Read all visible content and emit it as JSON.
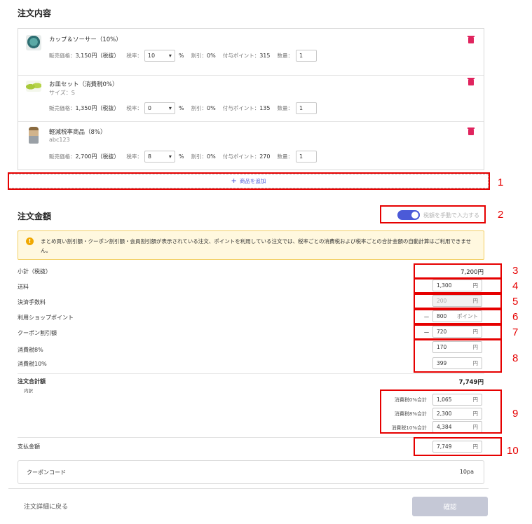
{
  "order_contents": {
    "title": "注文内容",
    "price_label": "販売価格：",
    "tax_rate_label": "税率：",
    "percent": "%",
    "discount_label": "割引：",
    "points_label": "付与ポイント：",
    "quantity_label": "数量：",
    "products": [
      {
        "name": "カップ＆ソーサー（10%）",
        "sub": "",
        "price": "3,150円（税抜）",
        "tax_rate": "10",
        "discount": "0%",
        "points": "315",
        "quantity": "1"
      },
      {
        "name": "お皿セット（消費税0%）",
        "sub": "サイズ：S",
        "price": "1,350円（税抜）",
        "tax_rate": "0",
        "discount": "0%",
        "points": "135",
        "quantity": "1"
      },
      {
        "name": "軽減税率商品（8%）",
        "sub": "abc123",
        "price": "2,700円（税抜）",
        "tax_rate": "8",
        "discount": "0%",
        "points": "270",
        "quantity": "1"
      }
    ],
    "add_product_label": "商品を追加"
  },
  "order_amount": {
    "title": "注文金額",
    "manual_toggle_label": "税額を手動で入力する",
    "manual_toggle_on": true,
    "notice": "まとめ買い割引額・クーポン割引額・会員割引額が表示されている注文、ポイントを利用している注文では、税率ごとの消費税および税率ごとの合計金額の自動計算はご利用できません。",
    "subtotal_label": "小計（税抜）",
    "subtotal_value": "7,200円",
    "shipping_label": "送料",
    "shipping_value": "1,300",
    "payment_fee_label": "決済手数料",
    "payment_fee_value": "200",
    "shop_points_label": "利用ショップポイント",
    "shop_points_value": "800",
    "points_unit": "ポイント",
    "coupon_discount_label": "クーポン割引額",
    "coupon_discount_value": "720",
    "tax8_label": "消費税8%",
    "tax8_value": "170",
    "tax10_label": "消費税10%",
    "tax10_value": "399",
    "total_label": "注文合計額",
    "total_value": "7,749円",
    "breakdown_label": "内訳",
    "total_tax0_label": "消費税0%合計",
    "total_tax0_value": "1,065",
    "total_tax8_label": "消費税8%合計",
    "total_tax8_value": "2,300",
    "total_tax10_label": "消費税10%合計",
    "total_tax10_value": "4,384",
    "payment_label": "支払金額",
    "payment_value": "7,749",
    "yen": "円",
    "minus": "－"
  },
  "coupon": {
    "label": "クーポンコード",
    "value": "10pa"
  },
  "footer": {
    "back_label": "注文詳細に戻る",
    "confirm_label": "確認"
  },
  "annotations": [
    "1",
    "2",
    "3",
    "4",
    "5",
    "6",
    "7",
    "8",
    "9",
    "10"
  ],
  "colors": {
    "accent": "#4b5ad8",
    "annotation_red": "#e60000",
    "delete_pink": "#e0245e",
    "notice_bg": "#fff8df"
  }
}
